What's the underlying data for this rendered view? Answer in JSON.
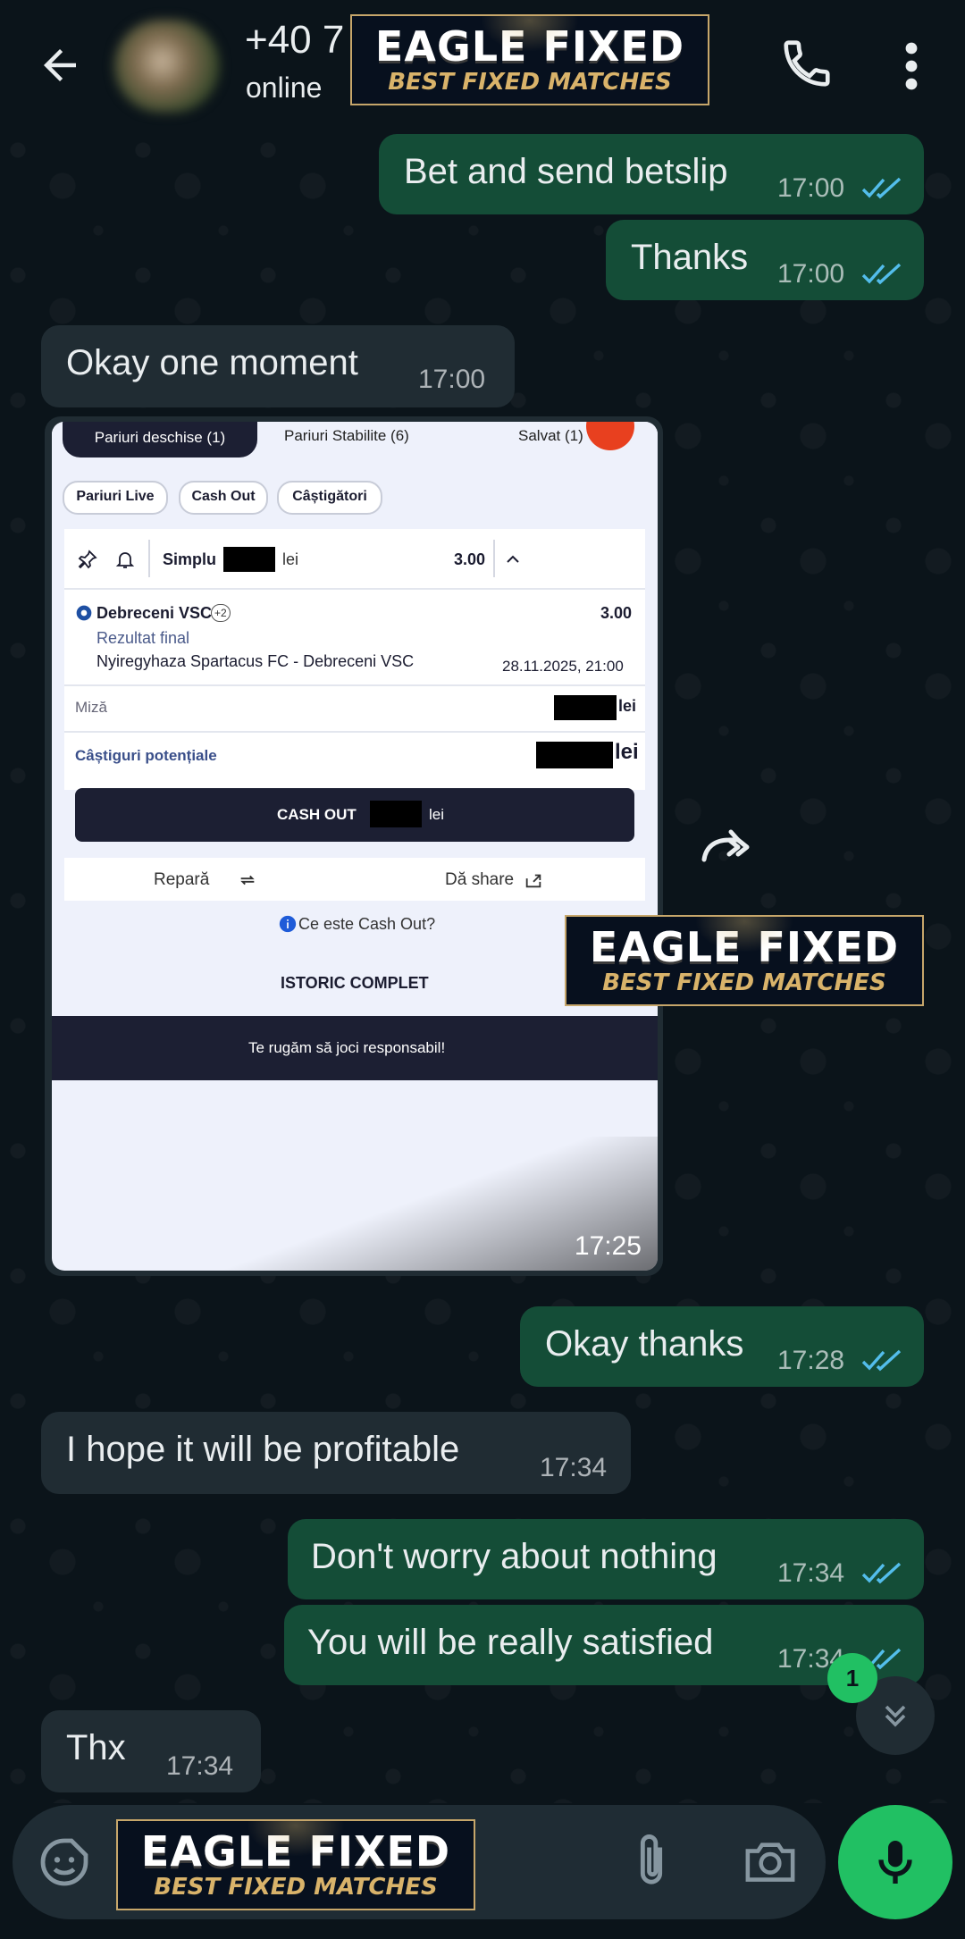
{
  "header": {
    "contact_name": "+40 7",
    "status": "online"
  },
  "watermark": {
    "line1": "EAGLE FIXED",
    "line2": "BEST FIXED MATCHES"
  },
  "messages": [
    {
      "direction": "out",
      "text": "Bet and send betslip",
      "time": "17:00",
      "read": true
    },
    {
      "direction": "out",
      "text": "Thanks",
      "time": "17:00",
      "read": true
    },
    {
      "direction": "in",
      "text": "Okay one moment",
      "time": "17:00"
    },
    {
      "direction": "in",
      "type": "image",
      "time": "17:25"
    },
    {
      "direction": "out",
      "text": "Okay thanks",
      "time": "17:28",
      "read": true
    },
    {
      "direction": "in",
      "text": "I hope it will be profitable",
      "time": "17:34"
    },
    {
      "direction": "out",
      "text": "Don't worry about nothing",
      "time": "17:34",
      "read": true
    },
    {
      "direction": "out",
      "text": "You will be really satisfied",
      "time": "17:34",
      "read": true
    },
    {
      "direction": "in",
      "text": "Thx",
      "time": "17:34"
    }
  ],
  "betslip": {
    "tabs": [
      "Pariuri deschise (1)",
      "Pariuri Stabilite (6)",
      "Salvat (1)"
    ],
    "chips": [
      "Pariuri Live",
      "Cash Out",
      "Câștigători"
    ],
    "bet_type": "Simplu",
    "currency": "lei",
    "total_odds": "3.00",
    "team": "Debreceni VSC",
    "team_badge": "+2",
    "selection_odds": "3.00",
    "market": "Rezultat final",
    "match": "Nyiregyhaza Spartacus FC - Debreceni VSC",
    "datetime": "28.11.2025, 21:00",
    "stake_label": "Miză",
    "potential_label": "Câștiguri potențiale",
    "cashout_label": "CASH OUT",
    "repair_label": "Repară",
    "share_label": "Dă share",
    "info_label": "Ce este Cash Out?",
    "history_label": "ISTORIC COMPLET",
    "responsible_label": "Te rugăm să joci responsabil!"
  },
  "unread_count": "1",
  "icons": {
    "back": "arrow-left-icon",
    "call": "phone-icon",
    "menu": "more-vert-icon",
    "forward": "forward-icon",
    "scroll": "chevron-double-down-icon",
    "sticker": "sticker-icon",
    "attach": "paperclip-icon",
    "camera": "camera-icon",
    "mic": "mic-icon"
  },
  "colors": {
    "outgoing_bubble": "#144d37",
    "incoming_bubble": "#202c33",
    "read_ticks": "#53bdeb",
    "accent_green": "#21c063"
  }
}
